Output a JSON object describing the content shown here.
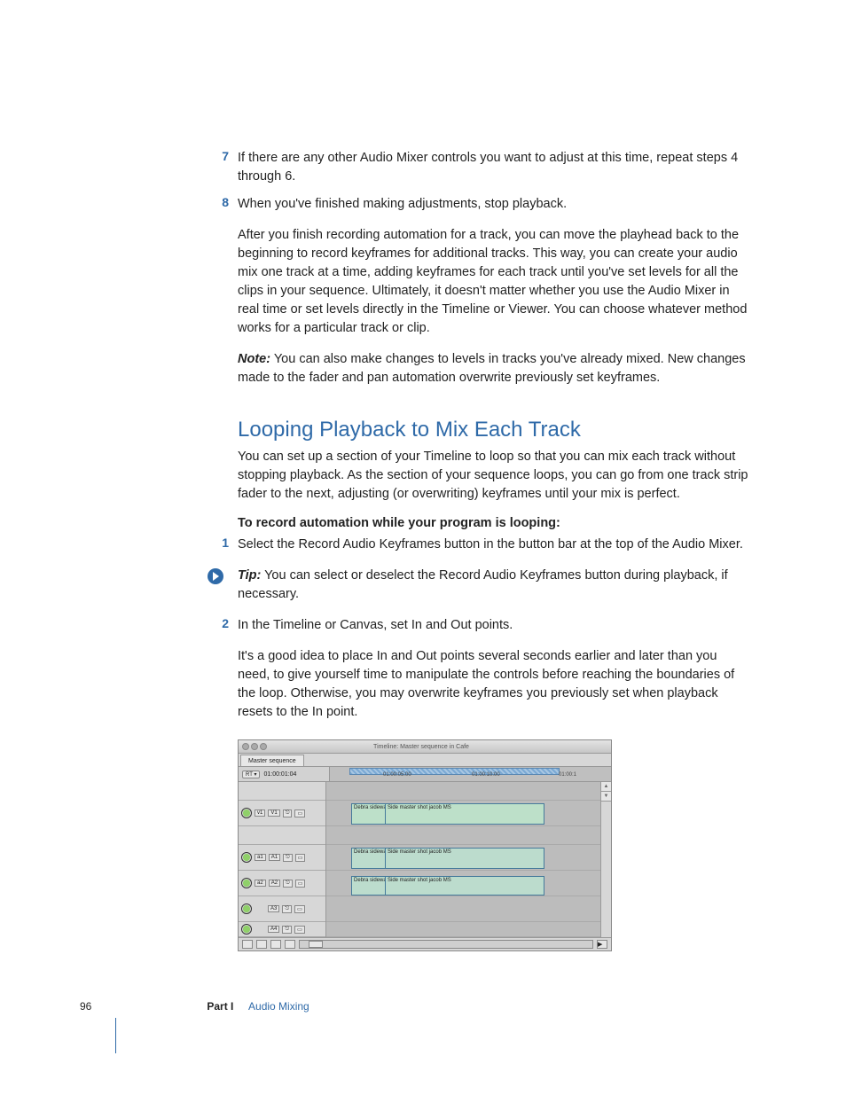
{
  "steps": {
    "s7_num": "7",
    "s7": "If there are any other Audio Mixer controls you want to adjust at this time, repeat steps 4 through 6.",
    "s8_num": "8",
    "s8": "When you've finished making adjustments, stop playback."
  },
  "para_after": "After you finish recording automation for a track, you can move the playhead back to the beginning to record keyframes for additional tracks. This way, you can create your audio mix one track at a time, adding keyframes for each track until you've set levels for all the clips in your sequence. Ultimately, it doesn't matter whether you use the Audio Mixer in real time or set levels directly in the Timeline or Viewer. You can choose whatever method works for a particular track or clip.",
  "note_label": "Note:",
  "note_text": "  You can also make changes to levels in tracks you've already mixed. New changes made to the fader and pan automation overwrite previously set keyframes.",
  "heading": "Looping Playback to Mix Each Track",
  "loop_intro": "You can set up a section of your Timeline to loop so that you can mix each track without stopping playback. As the section of your sequence loops, you can go from one track strip fader to the next, adjusting (or overwriting) keyframes until your mix is perfect.",
  "subhead": "To record automation while your program is looping:",
  "loop_steps": {
    "s1_num": "1",
    "s1": "Select the Record Audio Keyframes button in the button bar at the top of the Audio Mixer.",
    "s2_num": "2",
    "s2": "In the Timeline or Canvas, set In and Out points."
  },
  "tip_label": "Tip:",
  "tip_text": "  You can select or deselect the Record Audio Keyframes button during playback, if necessary.",
  "loop_para": "It's a good idea to place In and Out points several seconds earlier and later than you need, to give yourself time to manipulate the controls before reaching the boundaries of the loop. Otherwise, you may overwrite keyframes you previously set when playback resets to the In point.",
  "figure": {
    "title": "Timeline: Master sequence in Cafe",
    "tab": "Master sequence",
    "rt": "RT ▾",
    "timecode": "01:00:01:04",
    "tc1": "01:00:05:00",
    "tc2": "01:00:10:00",
    "tc3": "01:00:1",
    "tracks": {
      "v1_src": "v1",
      "v1": "V1",
      "a1_src": "a1",
      "a1": "A1",
      "a2_src": "a2",
      "a2": "A2",
      "a3": "A3",
      "a4": "A4",
      "lock": "🔒",
      "vis": "👁"
    },
    "clip_small": "Debra sidewa",
    "clip_big": "Side master shot jacob MS"
  },
  "footer": {
    "page": "96",
    "part": "Part I",
    "chapter": "Audio Mixing"
  }
}
